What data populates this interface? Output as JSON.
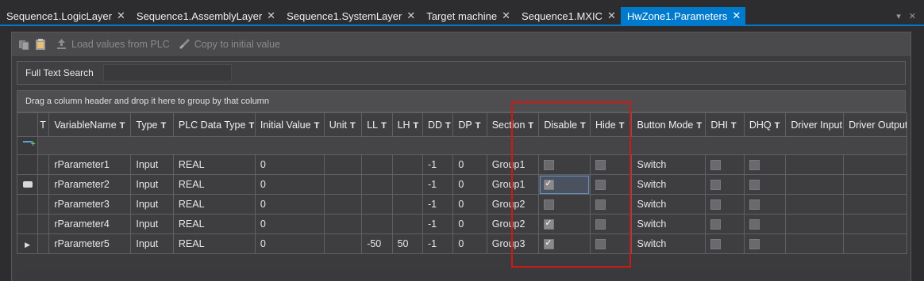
{
  "tabs": [
    {
      "label": "Sequence1.LogicLayer",
      "active": false
    },
    {
      "label": "Sequence1.AssemblyLayer",
      "active": false
    },
    {
      "label": "Sequence1.SystemLayer",
      "active": false
    },
    {
      "label": "Target machine",
      "active": false
    },
    {
      "label": "Sequence1.MXIC",
      "active": false
    },
    {
      "label": "HwZone1.Parameters",
      "active": true
    }
  ],
  "tab_close_glyph": "✕",
  "overflow_icons": [
    "▾",
    "✕"
  ],
  "toolbar": {
    "load_label": "Load values from PLC",
    "copy_label": "Copy to initial value",
    "icons": [
      "paste-icon",
      "clipboard-icon",
      "upload-icon",
      "brush-icon"
    ]
  },
  "search": {
    "label": "Full Text Search",
    "value": ""
  },
  "group_hint": "Drag a column header and drop it here to group by that column",
  "columns": [
    "VariableName",
    "Type",
    "PLC Data Type",
    "Initial Value",
    "Unit",
    "LL",
    "LH",
    "DD",
    "DP",
    "Section",
    "Disable",
    "Hide",
    "Button Mode",
    "DHI",
    "DHQ",
    "Driver Input",
    "Driver Output"
  ],
  "filter_glyph": "T",
  "rows": [
    {
      "name": "rParameter1",
      "type": "Input",
      "plc": "REAL",
      "init": "0",
      "unit": "",
      "ll": "",
      "lh": "",
      "dd": "-1",
      "dp": "0",
      "section": "Group1",
      "disable": false,
      "hide": false,
      "mode": "Switch",
      "dhi": false,
      "dhq": false,
      "indicator": ""
    },
    {
      "name": "rParameter2",
      "type": "Input",
      "plc": "REAL",
      "init": "0",
      "unit": "",
      "ll": "",
      "lh": "",
      "dd": "-1",
      "dp": "0",
      "section": "Group1",
      "disable": true,
      "hide": false,
      "mode": "Switch",
      "dhi": false,
      "dhq": false,
      "indicator": "edit"
    },
    {
      "name": "rParameter3",
      "type": "Input",
      "plc": "REAL",
      "init": "0",
      "unit": "",
      "ll": "",
      "lh": "",
      "dd": "-1",
      "dp": "0",
      "section": "Group2",
      "disable": false,
      "hide": false,
      "mode": "Switch",
      "dhi": false,
      "dhq": false,
      "indicator": ""
    },
    {
      "name": "rParameter4",
      "type": "Input",
      "plc": "REAL",
      "init": "0",
      "unit": "",
      "ll": "",
      "lh": "",
      "dd": "-1",
      "dp": "0",
      "section": "Group2",
      "disable": true,
      "hide": false,
      "mode": "Switch",
      "dhi": false,
      "dhq": false,
      "indicator": ""
    },
    {
      "name": "rParameter5",
      "type": "Input",
      "plc": "REAL",
      "init": "0",
      "unit": "",
      "ll": "-50",
      "lh": "50",
      "dd": "-1",
      "dp": "0",
      "section": "Group3",
      "disable": true,
      "hide": false,
      "mode": "Switch",
      "dhi": false,
      "dhq": false,
      "indicator": "current"
    }
  ],
  "colors": {
    "accent": "#007acc",
    "highlight_box": "#d01818"
  }
}
